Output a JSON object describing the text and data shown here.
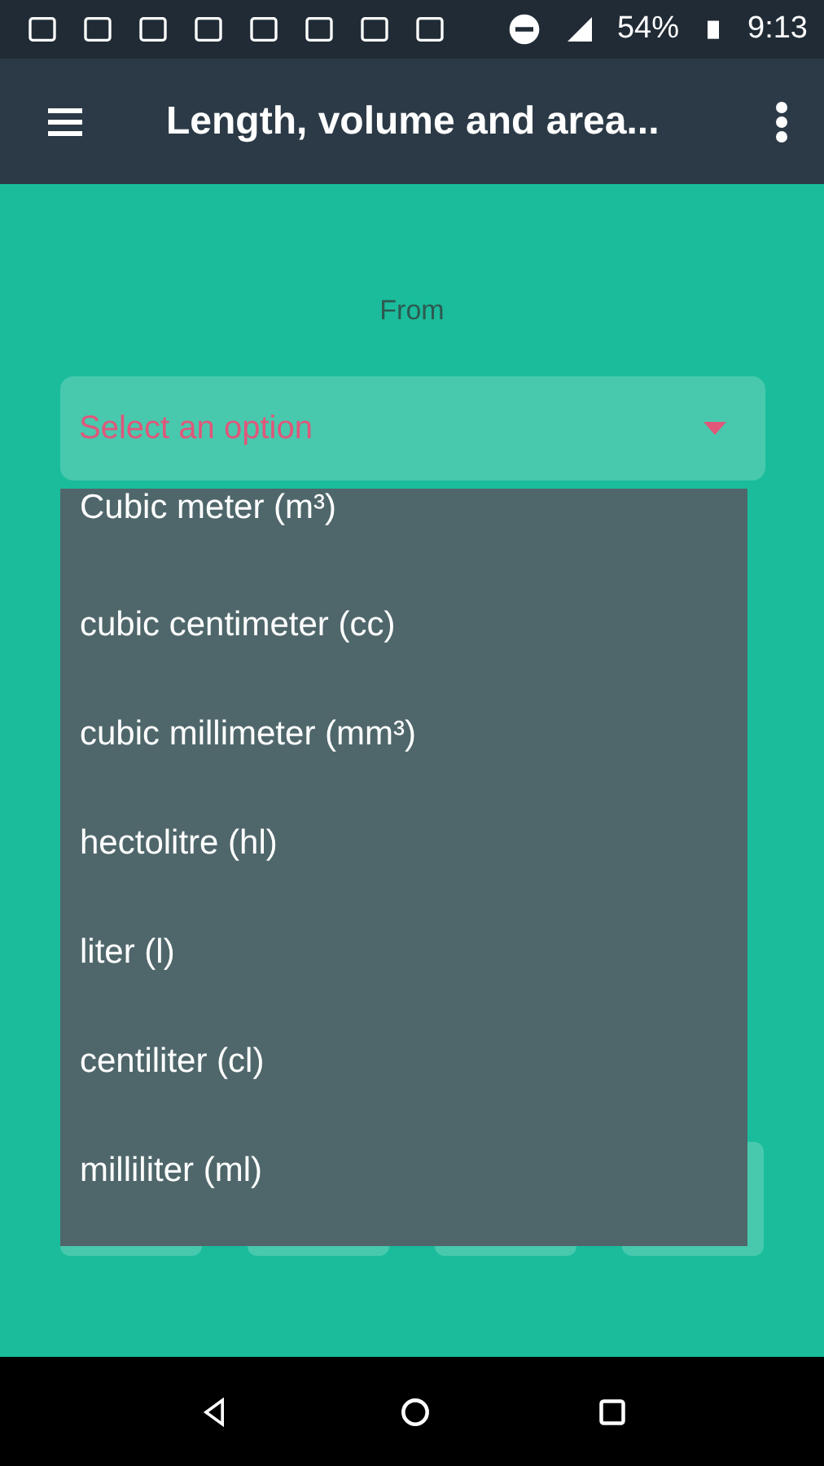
{
  "status_bar": {
    "battery": "54%",
    "time": "9:13"
  },
  "app_bar": {
    "title": "Length, volume and area..."
  },
  "from": {
    "label": "From",
    "select": {
      "placeholder": "Select an option",
      "expanded": true
    },
    "options": [
      {
        "label": "Cubic meter (m³)"
      },
      {
        "label": "cubic centimeter (cc)"
      },
      {
        "label": "cubic millimeter (mm³)"
      },
      {
        "label": "hectolitre (hl)"
      },
      {
        "label": "liter (l)"
      },
      {
        "label": "centiliter (cl)"
      },
      {
        "label": "milliliter (ml)"
      }
    ]
  }
}
